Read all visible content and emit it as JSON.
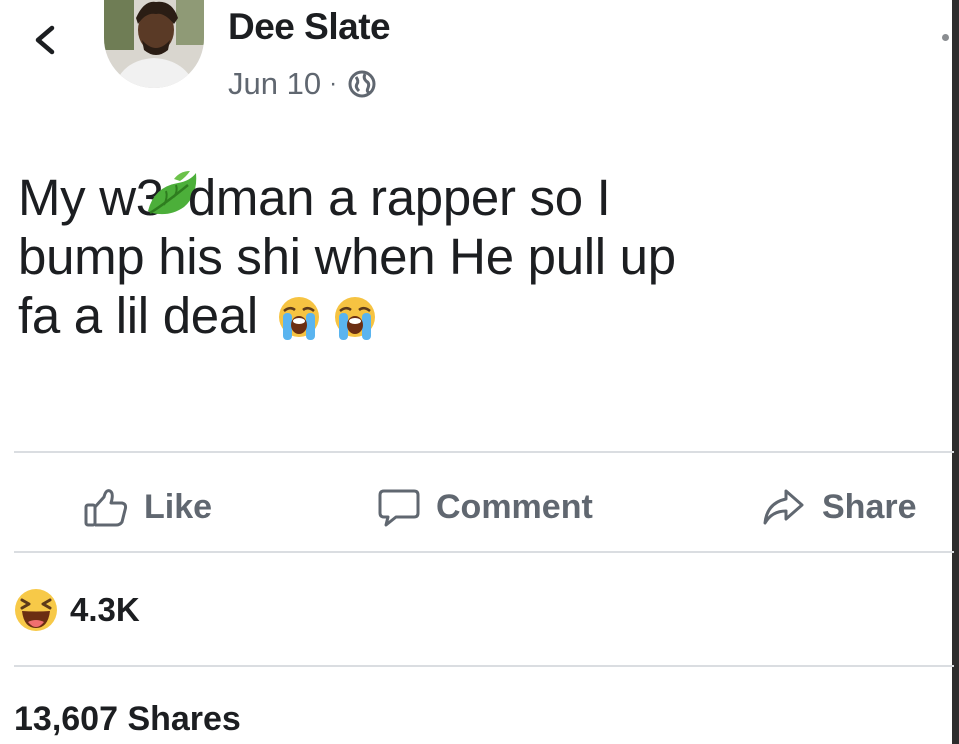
{
  "post": {
    "author": "Dee Slate",
    "date": "Jun 10",
    "separator": "·",
    "text_line1_a": "My w3",
    "text_line1_b": "dman a rapper so I",
    "text_line2": "bump his shi when He pull up",
    "text_line3": "fa a lil deal"
  },
  "actions": {
    "like": "Like",
    "comment": "Comment",
    "share": "Share"
  },
  "stats": {
    "reactions_count": "4.3K",
    "shares": "13,607 Shares"
  },
  "icons": {
    "back": "chevron-left-icon",
    "privacy": "globe-icon",
    "inline_emoji_1": "leaf-emoji",
    "inline_emoji_2": "loudly-crying-emoji",
    "reaction": "haha-reaction-icon"
  },
  "colors": {
    "text": "#1c1e21",
    "secondary": "#606770",
    "divider": "#dadde1"
  }
}
